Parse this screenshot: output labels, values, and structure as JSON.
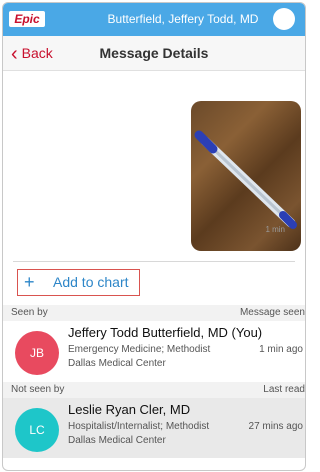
{
  "statusbar": {
    "logo": "Epic",
    "user": "Butterfield, Jeffery Todd, MD"
  },
  "nav": {
    "back_label": "Back",
    "title": "Message Details"
  },
  "message": {
    "timestamp": "1 min",
    "photo_icon": "pen-on-wood-photo"
  },
  "actions": {
    "add_to_chart": "Add to chart"
  },
  "seen": {
    "header_left": "Seen by",
    "header_right": "Message seen",
    "users": [
      {
        "initials": "JB",
        "color": "#e84a5f",
        "name": "Jeffery Todd Butterfield, MD (You)",
        "dept_line1": "Emergency Medicine; Methodist",
        "dept_line2": "Dallas Medical Center",
        "time": "1 min ago"
      }
    ]
  },
  "not_seen": {
    "header_left": "Not seen by",
    "header_right": "Last read",
    "users": [
      {
        "initials": "LC",
        "color": "#1ec6c9",
        "name": "Leslie Ryan Cler, MD",
        "dept_line1": "Hospitalist/Internalist; Methodist",
        "dept_line2": "Dallas Medical Center",
        "time": "27 mins ago"
      }
    ]
  },
  "colors": {
    "accent": "#c8102e",
    "statusbar": "#4aa8e6",
    "link": "#2d86c8"
  }
}
